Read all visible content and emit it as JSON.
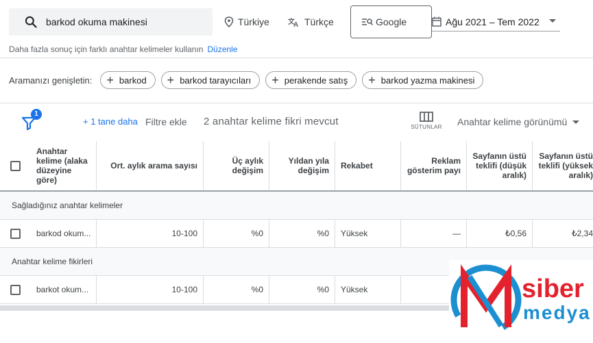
{
  "search": {
    "query": "barkod okuma makinesi"
  },
  "filters": {
    "location": "Türkiye",
    "language": "Türkçe",
    "engine": "Google",
    "date_range": "Ağu 2021 – Tem 2022"
  },
  "hint": {
    "text": "Daha fazla sonuç için farklı anahtar kelimeler kullanın",
    "link": "Düzenle"
  },
  "expand": {
    "label": "Aramanızı genişletin:",
    "chips": [
      "barkod",
      "barkod tarayıcıları",
      "perakende satış",
      "barkod yazma makinesi"
    ]
  },
  "toolbar": {
    "filter_badge": "1",
    "more_link": "+ 1 tane daha",
    "add_filter": "Filtre ekle",
    "idea_count": "2 anahtar kelime fikri mevcut",
    "columns_label": "SÜTUNLAR",
    "view_select": "Anahtar kelime görünümü"
  },
  "table": {
    "headers": {
      "keyword": "Anahtar kelime (alaka düzeyine göre)",
      "avg": "Ort. aylık arama sayısı",
      "three_month": "Üç aylık değişim",
      "yoy": "Yıldan yıla değişim",
      "competition": "Rekabet",
      "impression_share": "Reklam gösterim payı",
      "low_bid": "Sayfanın üstü teklifi (düşük aralık)",
      "high_bid": "Sayfanın üstü teklifi (yüksek aralık)"
    },
    "section1": "Sağladığınız anahtar kelimeler",
    "row1": {
      "keyword": "barkod okum...",
      "avg": "10-100",
      "three_month": "%0",
      "yoy": "%0",
      "competition": "Yüksek",
      "impression_share": "—",
      "low_bid": "₺0,56",
      "high_bid": "₺2,34"
    },
    "section2": "Anahtar kelime fikirleri",
    "row2": {
      "keyword": "barkot okum...",
      "avg": "10-100",
      "three_month": "%0",
      "yoy": "%0",
      "competition": "Yüksek"
    }
  },
  "logo": {
    "line1": "siber",
    "line2": "medya",
    "colors": {
      "red": "#e4222e",
      "blue": "#1c8fd1"
    }
  }
}
